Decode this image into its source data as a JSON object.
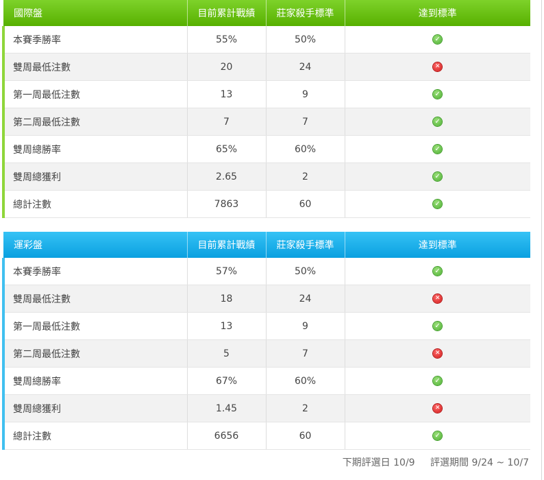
{
  "tables": [
    {
      "title": "國際盤",
      "columns": [
        "目前累計戰績",
        "莊家殺手標準",
        "達到標準"
      ],
      "rows": [
        {
          "label": "本賽季勝率",
          "current": "55%",
          "standard": "50%",
          "met": true
        },
        {
          "label": "雙周最低注數",
          "current": "20",
          "standard": "24",
          "met": false
        },
        {
          "label": "第一周最低注數",
          "current": "13",
          "standard": "9",
          "met": true
        },
        {
          "label": "第二周最低注數",
          "current": "7",
          "standard": "7",
          "met": true
        },
        {
          "label": "雙周總勝率",
          "current": "65%",
          "standard": "60%",
          "met": true
        },
        {
          "label": "雙周總獲利",
          "current": "2.65",
          "standard": "2",
          "met": true
        },
        {
          "label": "總計注數",
          "current": "7863",
          "standard": "60",
          "met": true
        }
      ]
    },
    {
      "title": "運彩盤",
      "columns": [
        "目前累計戰績",
        "莊家殺手標準",
        "達到標準"
      ],
      "rows": [
        {
          "label": "本賽季勝率",
          "current": "57%",
          "standard": "50%",
          "met": true
        },
        {
          "label": "雙周最低注數",
          "current": "18",
          "standard": "24",
          "met": false
        },
        {
          "label": "第一周最低注數",
          "current": "13",
          "standard": "9",
          "met": true
        },
        {
          "label": "第二周最低注數",
          "current": "5",
          "standard": "7",
          "met": false
        },
        {
          "label": "雙周總勝率",
          "current": "67%",
          "standard": "60%",
          "met": true
        },
        {
          "label": "雙周總獲利",
          "current": "1.45",
          "standard": "2",
          "met": false
        },
        {
          "label": "總計注數",
          "current": "6656",
          "standard": "60",
          "met": true
        }
      ]
    }
  ],
  "footer": {
    "next_selection": "下期評選日 10/9",
    "period": "評選期間 9/24 ~ 10/7"
  },
  "icons": {
    "met": "check-circle-icon",
    "not_met": "x-circle-icon"
  },
  "colors": {
    "intl_header": "#6cc21a",
    "lottery_header": "#1db3ef",
    "ok": "#4caf32",
    "fail": "#d11a1a"
  }
}
